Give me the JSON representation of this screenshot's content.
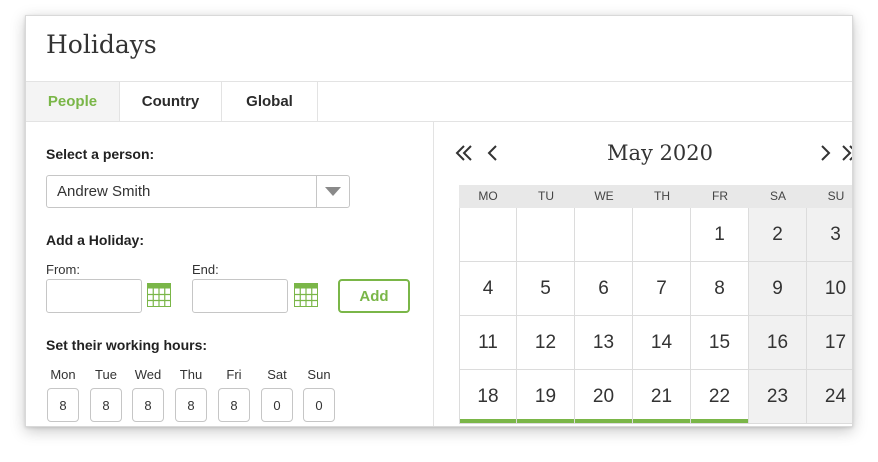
{
  "page": {
    "title": "Holidays"
  },
  "tabs": [
    {
      "label": "People",
      "active": true
    },
    {
      "label": "Country",
      "active": false
    },
    {
      "label": "Global",
      "active": false
    }
  ],
  "left": {
    "select_person_label": "Select a person:",
    "selected_person": "Andrew Smith",
    "add_holiday_label": "Add a Holiday:",
    "from_label": "From:",
    "end_label": "End:",
    "from_value": "",
    "end_value": "",
    "add_button_label": "Add",
    "working_hours_label": "Set their working hours:",
    "working_hours": [
      {
        "day": "Mon",
        "hours": "8"
      },
      {
        "day": "Tue",
        "hours": "8"
      },
      {
        "day": "Wed",
        "hours": "8"
      },
      {
        "day": "Thu",
        "hours": "8"
      },
      {
        "day": "Fri",
        "hours": "8"
      },
      {
        "day": "Sat",
        "hours": "0"
      },
      {
        "day": "Sun",
        "hours": "0"
      }
    ]
  },
  "calendar": {
    "month_label": "May 2020",
    "weekdays": [
      "MO",
      "TU",
      "WE",
      "TH",
      "FR",
      "SA",
      "SU"
    ],
    "weeks": [
      [
        "",
        "",
        "",
        "",
        "1",
        "2",
        "3"
      ],
      [
        "4",
        "5",
        "6",
        "7",
        "8",
        "9",
        "10"
      ],
      [
        "11",
        "12",
        "13",
        "14",
        "15",
        "16",
        "17"
      ],
      [
        "18",
        "19",
        "20",
        "21",
        "22",
        "23",
        "24"
      ]
    ],
    "highlighted_days": [
      "18",
      "19",
      "20",
      "21",
      "22"
    ]
  },
  "colors": {
    "accent": "#7ab648",
    "weekend_bg": "#f1f1f1",
    "border": "#dcdcdc"
  },
  "icons": {
    "calendar": "calendar-grid-icon",
    "double_prev": "double-chevron-left-icon",
    "prev": "chevron-left-icon",
    "next": "chevron-right-icon",
    "double_next": "double-chevron-right-icon",
    "dropdown": "caret-down-icon"
  }
}
